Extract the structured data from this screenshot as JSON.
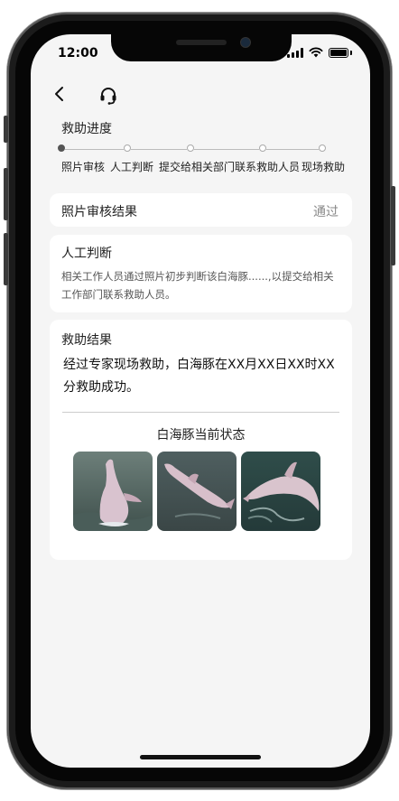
{
  "status_bar": {
    "time": "12:00"
  },
  "nav": {
    "back_icon": "chevron-left-icon",
    "support_icon": "headset-icon"
  },
  "progress": {
    "title": "救助进度",
    "current_step": 1,
    "steps": [
      {
        "label": "照片审核"
      },
      {
        "label": "人工判断"
      },
      {
        "label": "提交给相关部门"
      },
      {
        "label": "联系救助人员"
      },
      {
        "label": "现场救助"
      }
    ]
  },
  "photo_review": {
    "label": "照片审核结果",
    "value": "通过"
  },
  "manual_judgement": {
    "label": "人工判断",
    "text": "相关工作人员通过照片初步判断该白海豚......,以提交给相关工作部门联系救助人员。"
  },
  "rescue_result": {
    "label": "救助结果",
    "text": "经过专家现场救助，白海豚在XX月XX日XX时XX分救助成功。",
    "status_title": "白海豚当前状态",
    "photos": [
      "dolphin-photo-1",
      "dolphin-photo-2",
      "dolphin-photo-3"
    ]
  },
  "colors": {
    "screen_bg": "#f5f5f5",
    "card_bg": "#ffffff",
    "active_step": "#555555"
  }
}
